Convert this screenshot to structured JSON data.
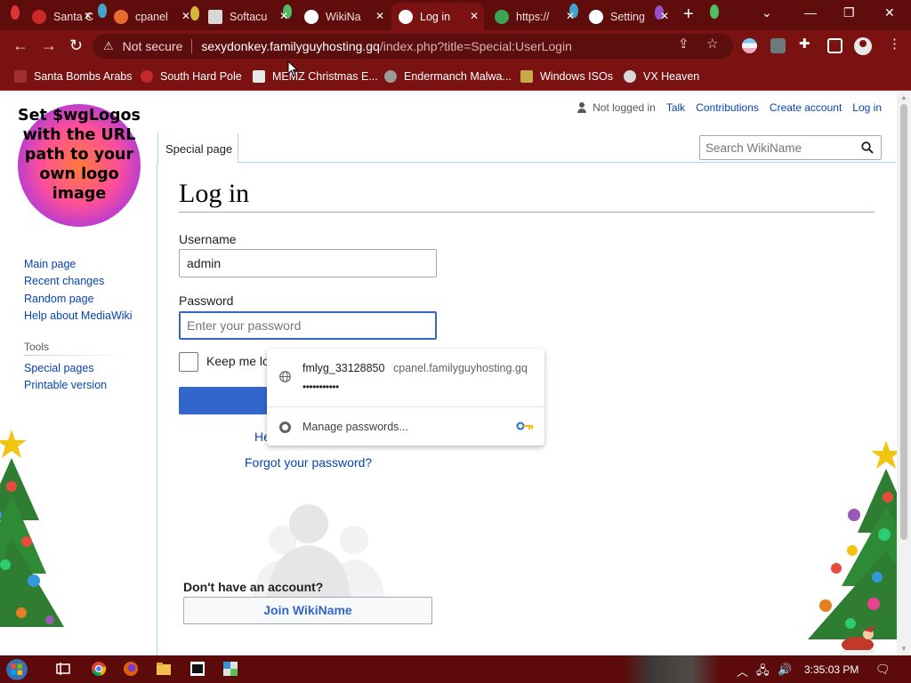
{
  "browser": {
    "tabs": [
      {
        "title": "Santa C",
        "favicon_color": "#cc2a2a"
      },
      {
        "title": "cpanel",
        "favicon_color": "#e86d2c"
      },
      {
        "title": "Softacu",
        "favicon_color": "#d8d8d8"
      },
      {
        "title": "WikiNa",
        "favicon_color": "#ffffff"
      },
      {
        "title": "Log in",
        "favicon_color": "#ffffff"
      },
      {
        "title": "https://",
        "favicon_color": "#3aa653"
      },
      {
        "title": "Setting",
        "favicon_color": "#ffffff"
      }
    ],
    "active_tab_index": 4,
    "address": {
      "security_label": "Not secure",
      "host": "sexydonkey.familyguyhosting.gq",
      "path": "/index.php?title=Special:UserLogin"
    },
    "bookmarks": [
      {
        "label": "Santa Bombs Arabs"
      },
      {
        "label": "South Hard Pole"
      },
      {
        "label": "MEMZ Christmas E..."
      },
      {
        "label": "Endermanch Malwa..."
      },
      {
        "label": "Windows ISOs"
      },
      {
        "label": "VX Heaven"
      }
    ]
  },
  "wiki": {
    "logo_text": "Set $wgLogos with the URL path to your own logo image",
    "personal": {
      "not_logged_in": "Not logged in",
      "talk": "Talk",
      "contributions": "Contributions",
      "create_account": "Create account",
      "log_in": "Log in"
    },
    "tab_label": "Special page",
    "search_placeholder": "Search WikiName",
    "navigation": [
      "Main page",
      "Recent changes",
      "Random page",
      "Help about MediaWiki"
    ],
    "tools_heading": "Tools",
    "tools": [
      "Special pages",
      "Printable version"
    ],
    "page_title": "Log in",
    "form": {
      "username_label": "Username",
      "username_value": "admin",
      "password_label": "Password",
      "password_placeholder": "Enter your password",
      "remember_label": "Keep me lo",
      "help_text": "He",
      "forgot_password": "Forgot your password?",
      "no_account": "Don't have an account?",
      "join_label": "Join WikiName"
    }
  },
  "autofill": {
    "username": "fmlyg_33128850",
    "site": "cpanel.familyguyhosting.gq",
    "masked_password": "•••••••••••",
    "manage_label": "Manage passwords..."
  },
  "taskbar": {
    "clock": "3:35:03 PM"
  },
  "colors": {
    "chrome_dark": "#5e0c0c",
    "chrome": "#7a1212",
    "wiki_link": "#0645ad",
    "accent_blue": "#3366cc"
  }
}
